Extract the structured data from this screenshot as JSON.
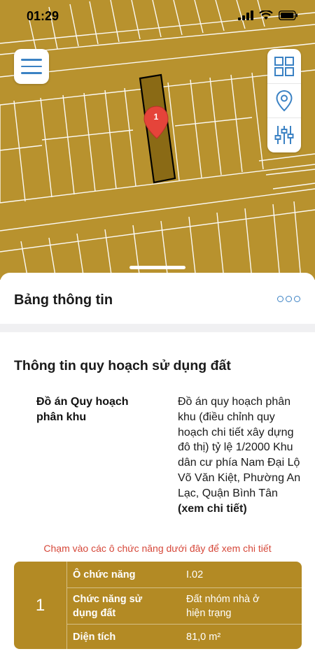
{
  "status_bar": {
    "time": "01:29"
  },
  "map": {
    "marker_label": "1"
  },
  "sheet": {
    "title": "Bảng thông tin",
    "section_title": "Thông tin quy hoạch sử dụng đất",
    "plan": {
      "label": "Đồ án Quy hoạch\nphân khu",
      "value": "Đồ án quy hoạch phân khu (điều chỉnh quy hoạch chi tiết xây dựng đô thị) tỷ lệ 1/2000 Khu dân cư phía Nam Đại Lộ Võ Văn Kiệt, Phường An Lạc, Quận Bình Tân",
      "link": "(xem chi tiết)"
    },
    "hint": "Chạm vào các ô chức năng dưới đây để xem chi tiết",
    "function_card": {
      "index": "1",
      "rows": [
        {
          "key": "Ô chức năng",
          "value": "I.02"
        },
        {
          "key": "Chức năng sử\ndụng đất",
          "value": "Đất nhóm nhà ở\nhiện trạng"
        },
        {
          "key": "Diện tích",
          "value": "81,0 m²"
        }
      ]
    }
  },
  "colors": {
    "map_fill": "#b8922e",
    "accent": "#3b82c4",
    "card": "#b38a24",
    "hint": "#d6483a",
    "marker": "#e5443a"
  },
  "icons": [
    "menu-icon",
    "grid-icon",
    "location-icon",
    "sliders-icon",
    "more-icon",
    "map-marker-icon"
  ]
}
